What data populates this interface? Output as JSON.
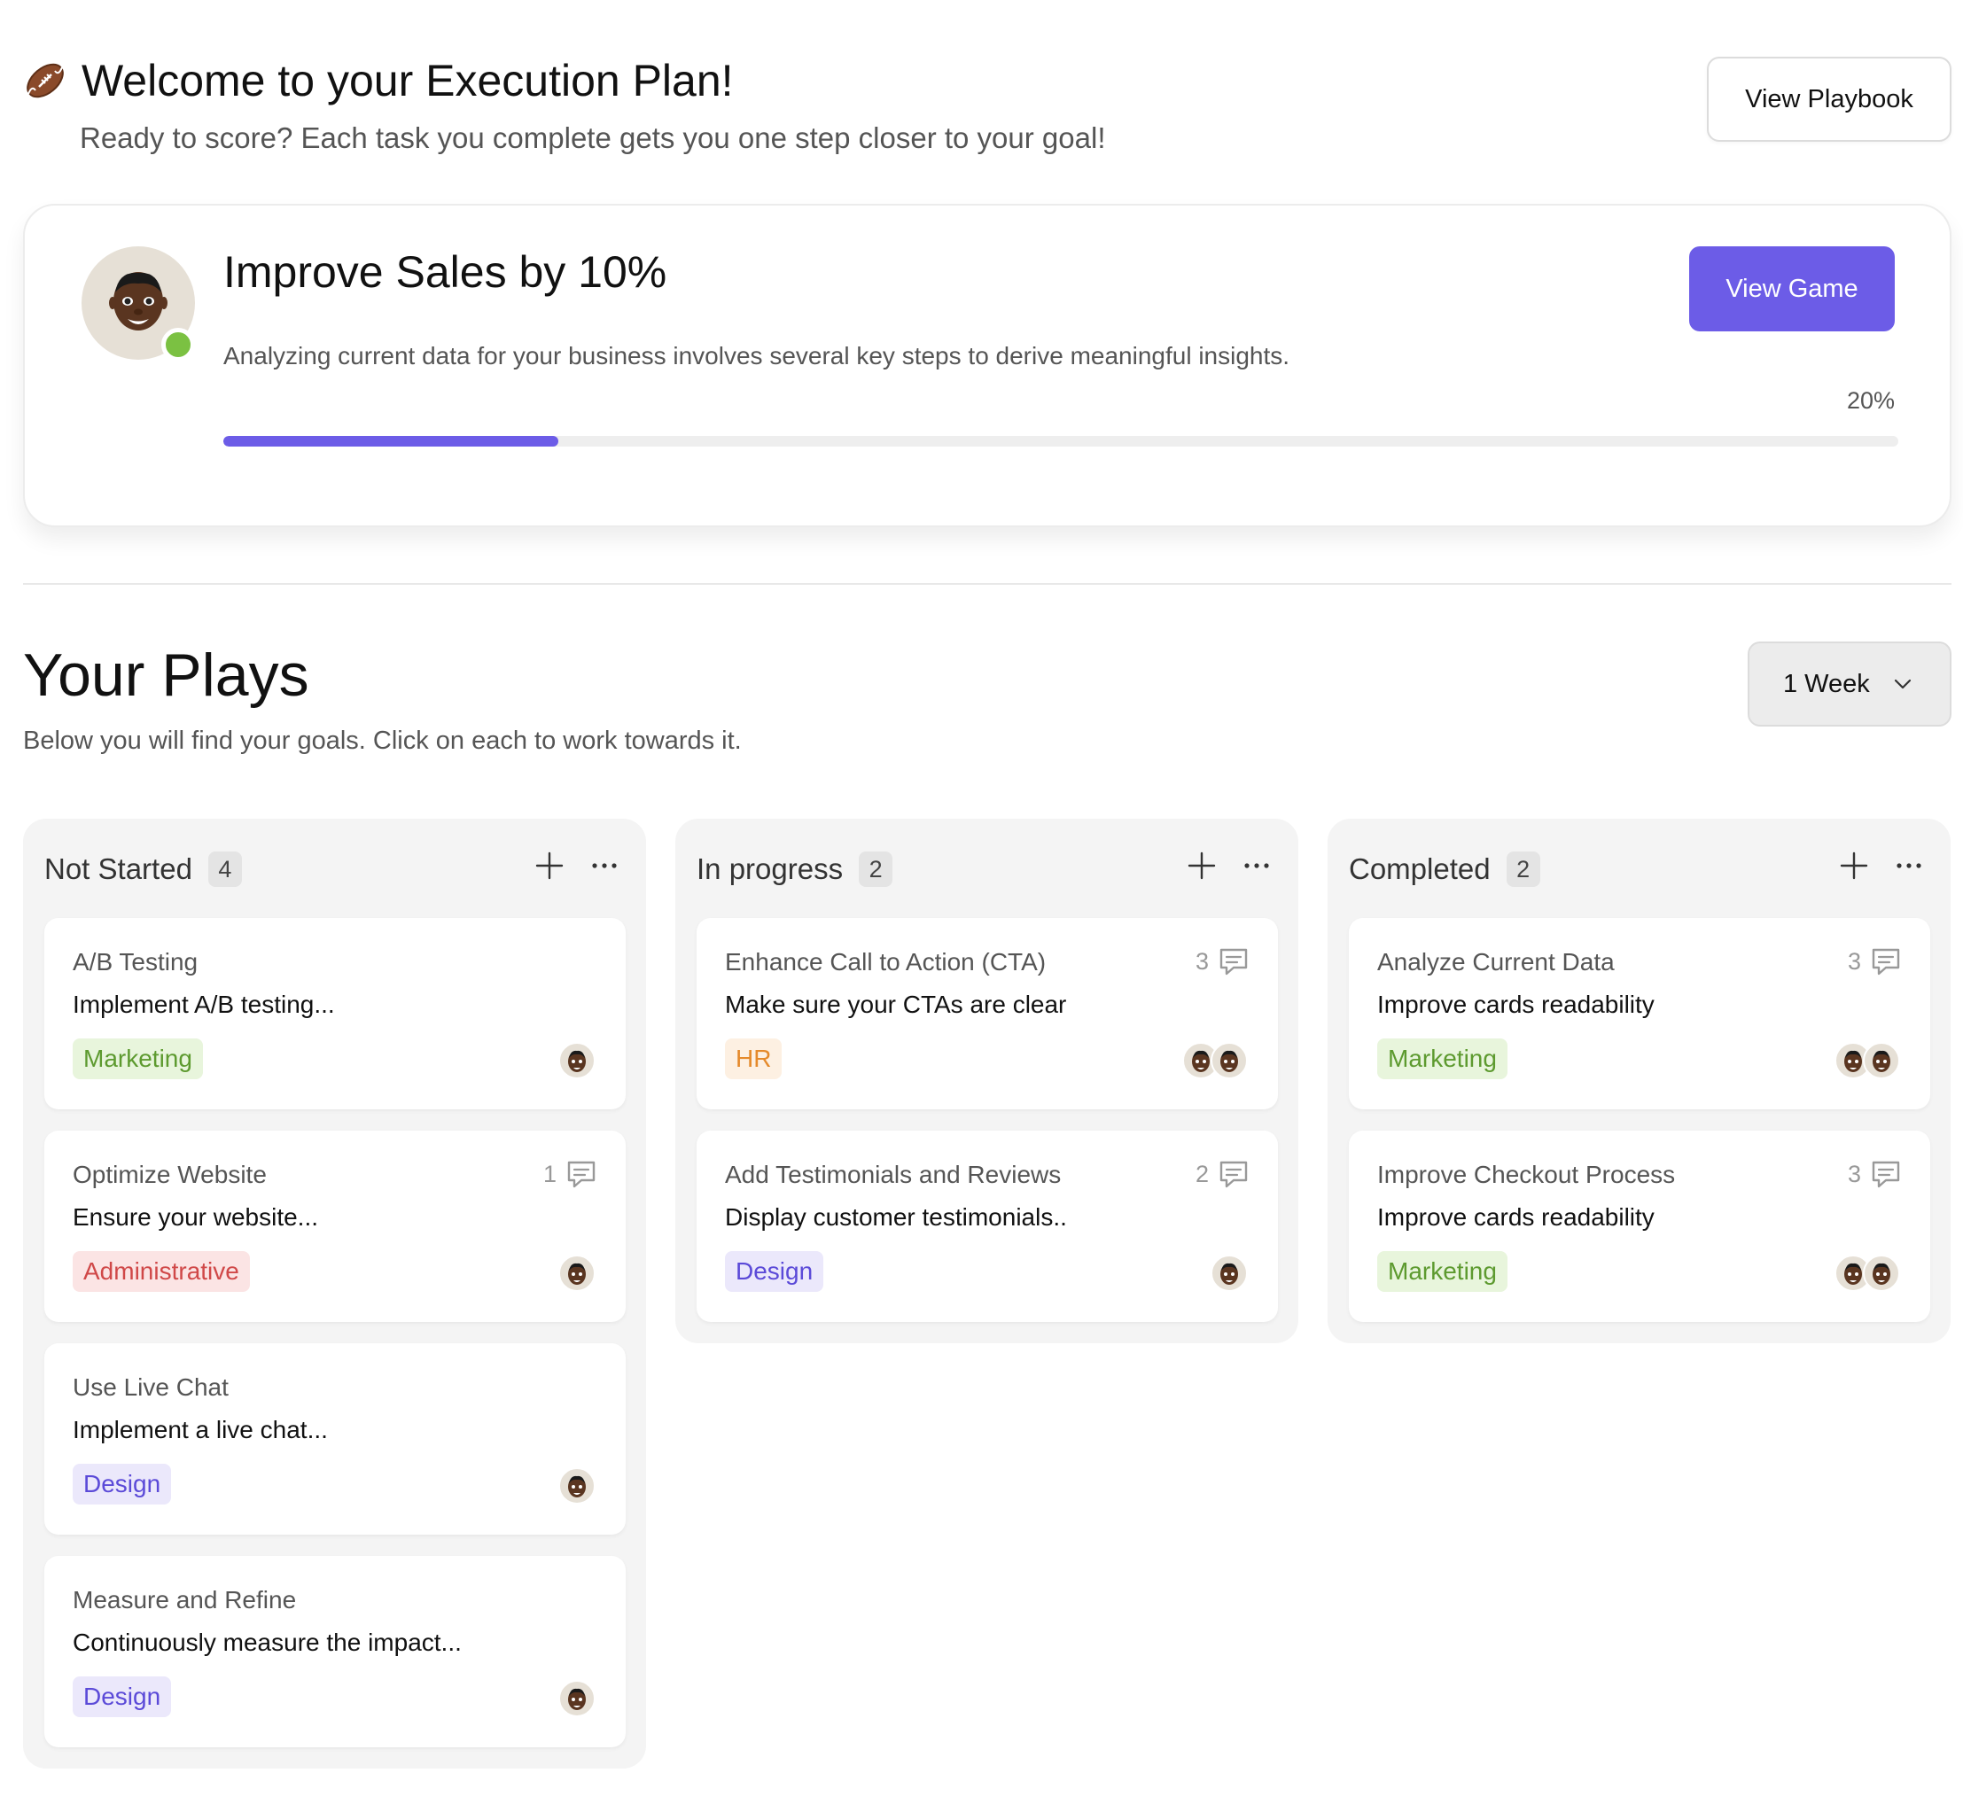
{
  "header": {
    "title": "Welcome to your Execution Plan!",
    "subtitle": "Ready to score? Each task you complete gets you one step closer to your goal!",
    "playbook_button": "View Playbook",
    "icon": "football-icon"
  },
  "goal": {
    "title": "Improve Sales by 10%",
    "description": "Analyzing current data for your business involves several key steps to derive meaningful insights.",
    "game_button": "View Game",
    "progress_label": "20%",
    "progress_fraction": 0.2,
    "accent_color": "#6c5ce7",
    "online_status_color": "#7bc142"
  },
  "plays": {
    "title": "Your Plays",
    "subtitle": "Below you will find your goals. Click on each to work towards it.",
    "period_select": "1 Week"
  },
  "columns": [
    {
      "title": "Not Started",
      "count": "4",
      "cards": [
        {
          "title": "A/B Testing",
          "desc": "Implement A/B testing...",
          "tag": "Marketing",
          "comments": "",
          "avatars": 1
        },
        {
          "title": "Optimize Website",
          "desc": "Ensure your website...",
          "tag": "Administrative",
          "comments": "1",
          "avatars": 1
        },
        {
          "title": "Use Live Chat",
          "desc": "Implement a live chat...",
          "tag": "Design",
          "comments": "",
          "avatars": 1
        },
        {
          "title": "Measure and Refine",
          "desc": "Continuously measure the impact...",
          "tag": "Design",
          "comments": "",
          "avatars": 1
        }
      ]
    },
    {
      "title": "In progress",
      "count": "2",
      "cards": [
        {
          "title": "Enhance Call to Action (CTA)",
          "desc": "Make sure your CTAs are clear",
          "tag": "HR",
          "comments": "3",
          "avatars": 2
        },
        {
          "title": "Add Testimonials and Reviews",
          "desc": "Display customer testimonials..",
          "tag": "Design",
          "comments": "2",
          "avatars": 1
        }
      ]
    },
    {
      "title": "Completed",
      "count": "2",
      "cards": [
        {
          "title": "Analyze Current Data",
          "desc": "Improve cards readability",
          "tag": "Marketing",
          "comments": "3",
          "avatars": 2
        },
        {
          "title": "Improve Checkout Process",
          "desc": "Improve cards readability",
          "tag": "Marketing",
          "comments": "3",
          "avatars": 2
        }
      ]
    }
  ]
}
